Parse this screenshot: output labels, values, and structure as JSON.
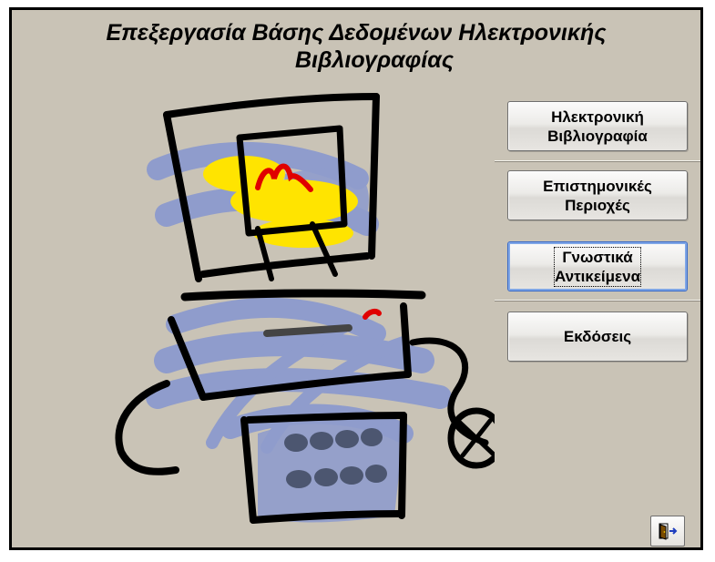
{
  "form": {
    "title_line1": "Επεξεργασία Βάσης Δεδομένων Ηλεκτρονικής",
    "title_line2": "Βιβλιογραφίας"
  },
  "buttons": [
    {
      "line1": "Ηλεκτρονική",
      "line2": "Βιβλιογραφία"
    },
    {
      "line1": "Επιστημονικές",
      "line2": "Περιοχές"
    },
    {
      "line1": "Γνωστικά",
      "line2": "Αντικείμενα"
    },
    {
      "line1": "Εκδόσεις",
      "line2": ""
    }
  ],
  "exit_button": {
    "icon": "exit-door-icon"
  },
  "colors": {
    "form_background": "#c9c3b6",
    "clipart_blue": "#8f9ccc",
    "clipart_yellow": "#ffe400",
    "clipart_red": "#e00000"
  }
}
